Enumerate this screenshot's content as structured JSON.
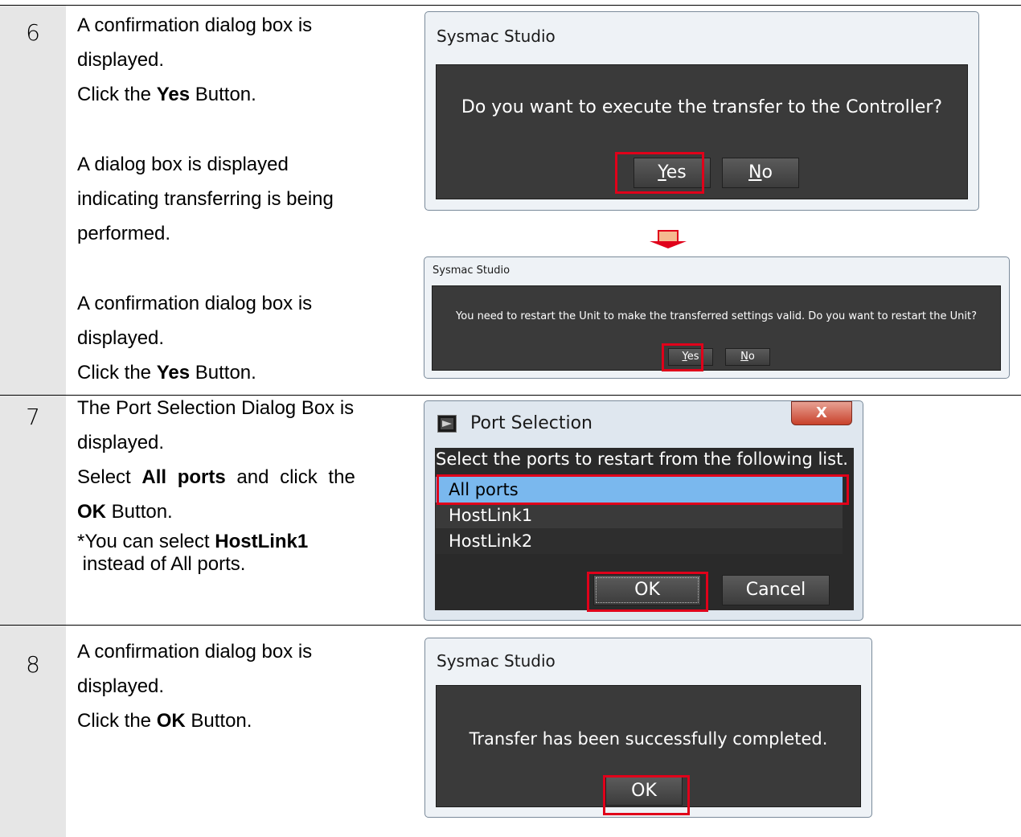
{
  "steps": [
    {
      "number": "6",
      "text1_line1": "A confirmation dialog box is",
      "text1_line2": "displayed.",
      "text1_line3_pre": "Click the ",
      "text1_line3_bold": "Yes",
      "text1_line3_post": " Button.",
      "text2_line1": "A dialog box is displayed",
      "text2_line2": "indicating transferring is being",
      "text2_line3": "performed.",
      "text3_line1": "A confirmation dialog box is",
      "text3_line2": "displayed.",
      "text3_line3_pre": "Click the ",
      "text3_line3_bold": "Yes",
      "text3_line3_post": " Button."
    },
    {
      "number": "7",
      "line1": "The Port Selection Dialog Box is",
      "line2": "displayed.",
      "line3_pre": "Select ",
      "line3_bold": "All ports",
      "line3_post": " and click the",
      "line4_bold": "OK",
      "line4_post": " Button.",
      "line5_pre": "*You can select ",
      "line5_bold": "HostLink1",
      "line6": " instead of All ports."
    },
    {
      "number": "8",
      "line1": "A confirmation dialog box is",
      "line2": "displayed.",
      "line3_pre": "Click the ",
      "line3_bold": "OK",
      "line3_post": " Button."
    }
  ],
  "dialog1": {
    "title": "Sysmac Studio",
    "message": "Do you want to execute the transfer to the Controller?",
    "yes_label_u": "Y",
    "yes_label_rest": "es",
    "no_label_u": "N",
    "no_label_rest": "o"
  },
  "dialog2": {
    "title": "Sysmac Studio",
    "message": "You need to restart the Unit to make the transferred settings valid. Do you want to restart the Unit?",
    "yes_label_u": "Y",
    "yes_label_rest": "es",
    "no_label_u": "N",
    "no_label_rest": "o"
  },
  "port_dialog": {
    "title": "Port Selection",
    "close_label": "X",
    "instruction": "Select the ports to restart from the following list.",
    "items": [
      "All ports",
      "HostLink1",
      "HostLink2"
    ],
    "selected_index": 0,
    "ok_label": "OK",
    "cancel_label": "Cancel"
  },
  "dialog3": {
    "title": "Sysmac Studio",
    "message": "Transfer has been successfully completed.",
    "ok_label": "OK"
  },
  "colors": {
    "highlight": "#e0001a",
    "selected_item": "#7ab8ee",
    "number_column": "#e6e6e6",
    "dialog_body": "#3a3a3a"
  }
}
